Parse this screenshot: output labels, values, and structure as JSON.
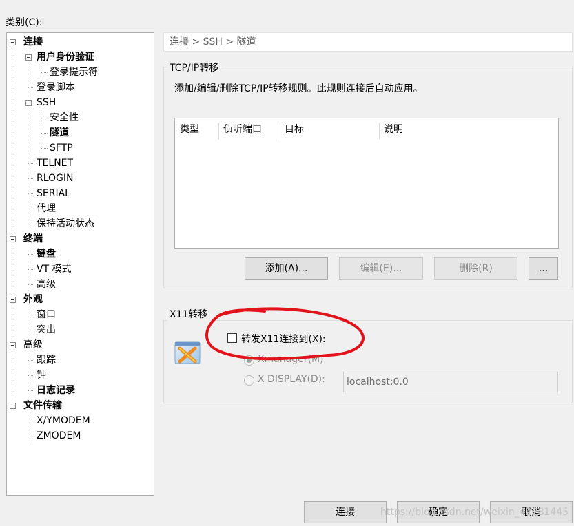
{
  "category_label": "类别(C):",
  "tree": [
    {
      "label": "连接",
      "level": 0,
      "bold": true,
      "expander": true
    },
    {
      "label": "用户身份验证",
      "level": 1,
      "bold": true,
      "expander": true
    },
    {
      "label": "登录提示符",
      "level": 2
    },
    {
      "label": "登录脚本",
      "level": 1
    },
    {
      "label": "SSH",
      "level": 1,
      "expander": true
    },
    {
      "label": "安全性",
      "level": 2
    },
    {
      "label": "隧道",
      "level": 2,
      "selected": true
    },
    {
      "label": "SFTP",
      "level": 2
    },
    {
      "label": "TELNET",
      "level": 1
    },
    {
      "label": "RLOGIN",
      "level": 1
    },
    {
      "label": "SERIAL",
      "level": 1
    },
    {
      "label": "代理",
      "level": 1
    },
    {
      "label": "保持活动状态",
      "level": 1
    },
    {
      "label": "终端",
      "level": 0,
      "bold": true,
      "expander": true
    },
    {
      "label": "键盘",
      "level": 1,
      "bold": true
    },
    {
      "label": "VT 模式",
      "level": 1
    },
    {
      "label": "高级",
      "level": 1
    },
    {
      "label": "外观",
      "level": 0,
      "bold": true,
      "expander": true
    },
    {
      "label": "窗口",
      "level": 1
    },
    {
      "label": "突出",
      "level": 1
    },
    {
      "label": "高级",
      "level": 0,
      "expander": true
    },
    {
      "label": "跟踪",
      "level": 1
    },
    {
      "label": "钟",
      "level": 1
    },
    {
      "label": "日志记录",
      "level": 1,
      "bold": true
    },
    {
      "label": "文件传输",
      "level": 0,
      "bold": true,
      "expander": true
    },
    {
      "label": "X/YMODEM",
      "level": 1
    },
    {
      "label": "ZMODEM",
      "level": 1
    }
  ],
  "breadcrumb": "连接 > SSH > 隧道",
  "tcp": {
    "title": "TCP/IP转移",
    "description": "添加/编辑/删除TCP/IP转移规则。此规则连接后自动应用。",
    "columns": [
      "类型",
      "侦听端口",
      "目标",
      "说明"
    ],
    "add_label": "添加(A)...",
    "edit_label": "编辑(E)...",
    "delete_label": "删除(R)",
    "more_label": "..."
  },
  "x11": {
    "title": "X11转移",
    "forward_label": "转发X11连接到(X):",
    "xmanager_label": "Xmanager(M)",
    "xdisplay_label": "X DISPLAY(D):",
    "display_value": "localhost:0.0"
  },
  "footer": {
    "connect_label": "连接",
    "ok_label": "确定",
    "cancel_label": "取消"
  },
  "watermark": "https://blog.csdn.net/weixin_42281445",
  "colors": {
    "annotation_red": "#e0141a"
  }
}
